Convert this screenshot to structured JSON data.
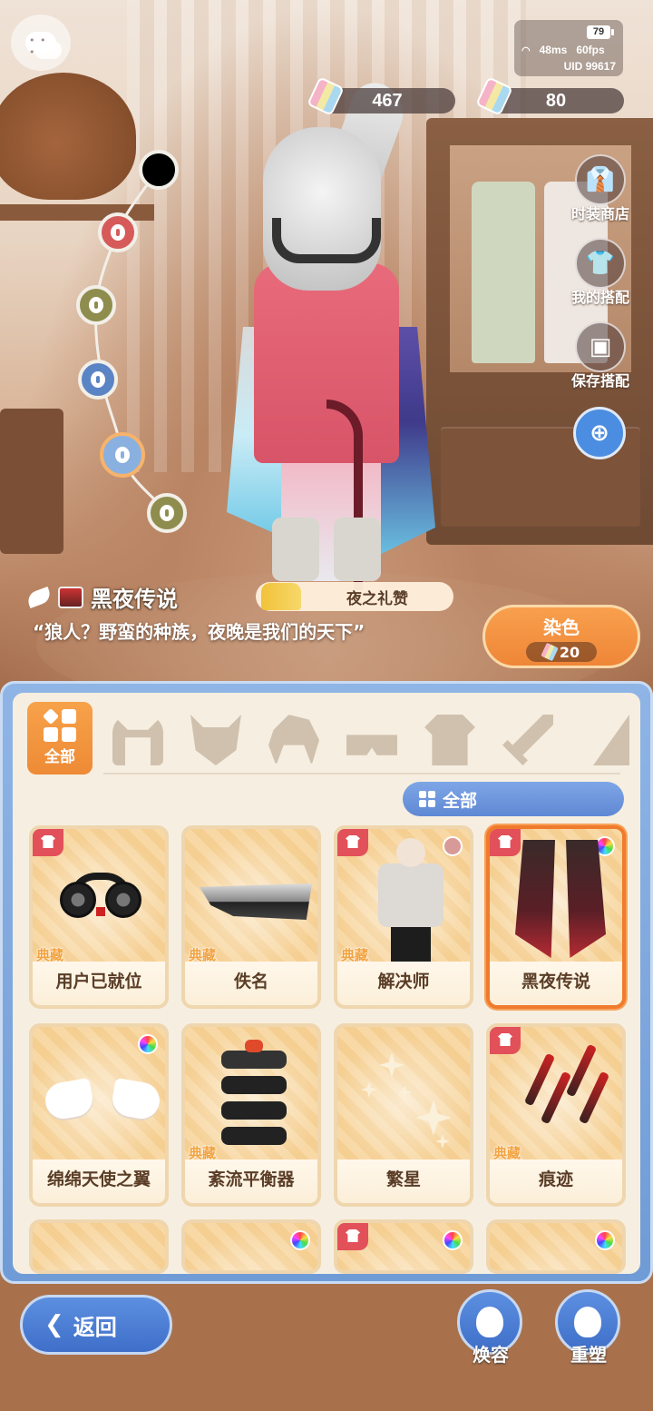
{
  "status": {
    "battery": "79",
    "ping": "48ms",
    "fps": "60fps",
    "uid": "UID 99617"
  },
  "currency": {
    "primary": "467",
    "secondary": "80"
  },
  "side_menu": {
    "fashion_shop": "时装商店",
    "my_outfits": "我的搭配",
    "save_outfit": "保存搭配"
  },
  "outfit": {
    "name": "黑夜传说",
    "set_name": "夜之礼赞",
    "quote": "“狼人？野蛮的种族，夜晚是我们的天下”"
  },
  "dye": {
    "label": "染色",
    "cost": "20"
  },
  "category": {
    "all_label": "全部",
    "icons": [
      "cat-ears-icon",
      "mask-icon",
      "hair-icon",
      "glasses-icon",
      "top-icon",
      "sword-icon",
      "more-icon"
    ]
  },
  "filter": {
    "label": "全部"
  },
  "items": [
    {
      "name": "用户已就位",
      "rarity": "典藏",
      "tag": true,
      "badge": "none"
    },
    {
      "name": "佚名",
      "rarity": "典藏",
      "tag": false,
      "badge": "none"
    },
    {
      "name": "解决师",
      "rarity": "典藏",
      "tag": true,
      "badge": "pink"
    },
    {
      "name": "黑夜传说",
      "rarity": "",
      "tag": true,
      "badge": "rainbow",
      "selected": true
    },
    {
      "name": "绵绵天使之翼",
      "rarity": "",
      "tag": false,
      "badge": "rainbow"
    },
    {
      "name": "紊流平衡器",
      "rarity": "典藏",
      "tag": false,
      "badge": "none"
    },
    {
      "name": "繁星",
      "rarity": "",
      "tag": false,
      "badge": "none"
    },
    {
      "name": "痕迹",
      "rarity": "典藏",
      "tag": true,
      "badge": "none"
    }
  ],
  "bottom": {
    "back": "返回",
    "makeover": "焕容",
    "reshape": "重塑"
  },
  "colors": {
    "accent_orange": "#ef8638",
    "accent_blue": "#4b7fd6",
    "panel_bg": "#f6efe1",
    "node_black": "#000000",
    "node_red": "#d65a5a",
    "node_olive": "#8f8d4e",
    "node_blue": "#5b84c4",
    "node_lightblue": "#8ab0df",
    "node_olive2": "#8f8d4e"
  }
}
